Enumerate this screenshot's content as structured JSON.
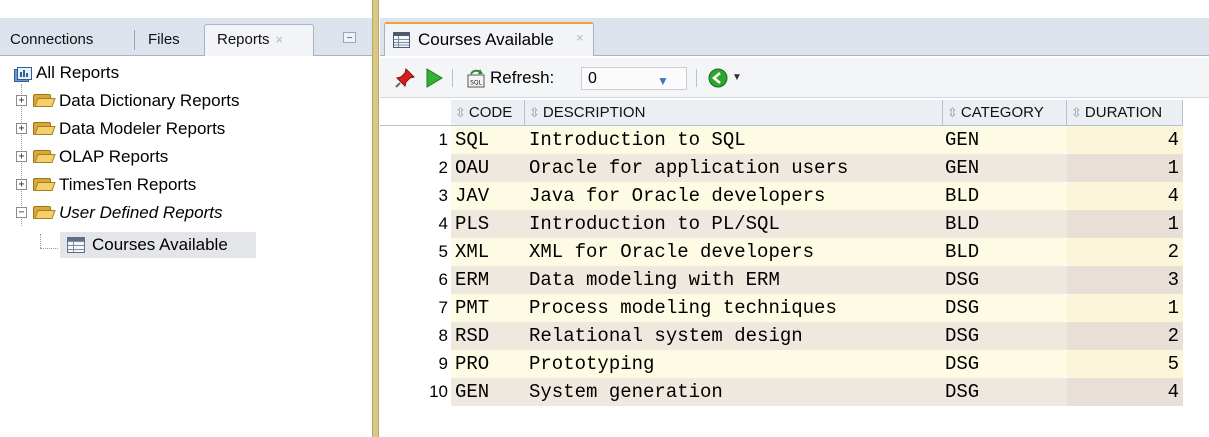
{
  "left_panel": {
    "tabs": [
      {
        "label": "Connections"
      },
      {
        "label": "Files"
      },
      {
        "label": "Reports",
        "close": "×"
      }
    ],
    "tree": {
      "root": "All Reports",
      "children": [
        {
          "label": "Data Dictionary Reports"
        },
        {
          "label": "Data Modeler Reports"
        },
        {
          "label": "OLAP Reports"
        },
        {
          "label": "TimesTen Reports"
        },
        {
          "label": "User Defined Reports",
          "italic": true,
          "expanded": true
        }
      ],
      "leaf": "Courses Available"
    }
  },
  "editor": {
    "tab": {
      "label": "Courses Available",
      "close": "×"
    },
    "toolbar": {
      "refresh_label": "Refresh:",
      "refresh_value": "0"
    },
    "grid": {
      "columns": [
        "CODE",
        "DESCRIPTION",
        "CATEGORY",
        "DURATION"
      ],
      "rows": [
        {
          "n": "1",
          "code": "SQL",
          "description": "Introduction to SQL",
          "category": "GEN",
          "duration": "4"
        },
        {
          "n": "2",
          "code": "OAU",
          "description": "Oracle for application users",
          "category": "GEN",
          "duration": "1"
        },
        {
          "n": "3",
          "code": "JAV",
          "description": "Java for Oracle developers",
          "category": "BLD",
          "duration": "4"
        },
        {
          "n": "4",
          "code": "PLS",
          "description": "Introduction to PL/SQL",
          "category": "BLD",
          "duration": "1"
        },
        {
          "n": "5",
          "code": "XML",
          "description": "XML for Oracle developers",
          "category": "BLD",
          "duration": "2"
        },
        {
          "n": "6",
          "code": "ERM",
          "description": "Data modeling with ERM",
          "category": "DSG",
          "duration": "3"
        },
        {
          "n": "7",
          "code": "PMT",
          "description": "Process modeling techniques",
          "category": "DSG",
          "duration": "1"
        },
        {
          "n": "8",
          "code": "RSD",
          "description": "Relational system design",
          "category": "DSG",
          "duration": "2"
        },
        {
          "n": "9",
          "code": "PRO",
          "description": "Prototyping",
          "category": "DSG",
          "duration": "5"
        },
        {
          "n": "10",
          "code": "GEN",
          "description": "System generation",
          "category": "DSG",
          "duration": "4"
        }
      ]
    }
  },
  "colors": {
    "row_odd": "#fdfbe3",
    "row_even": "#efe8df",
    "splitter": "#d8c888",
    "tab_accent": "#e9a33a"
  }
}
